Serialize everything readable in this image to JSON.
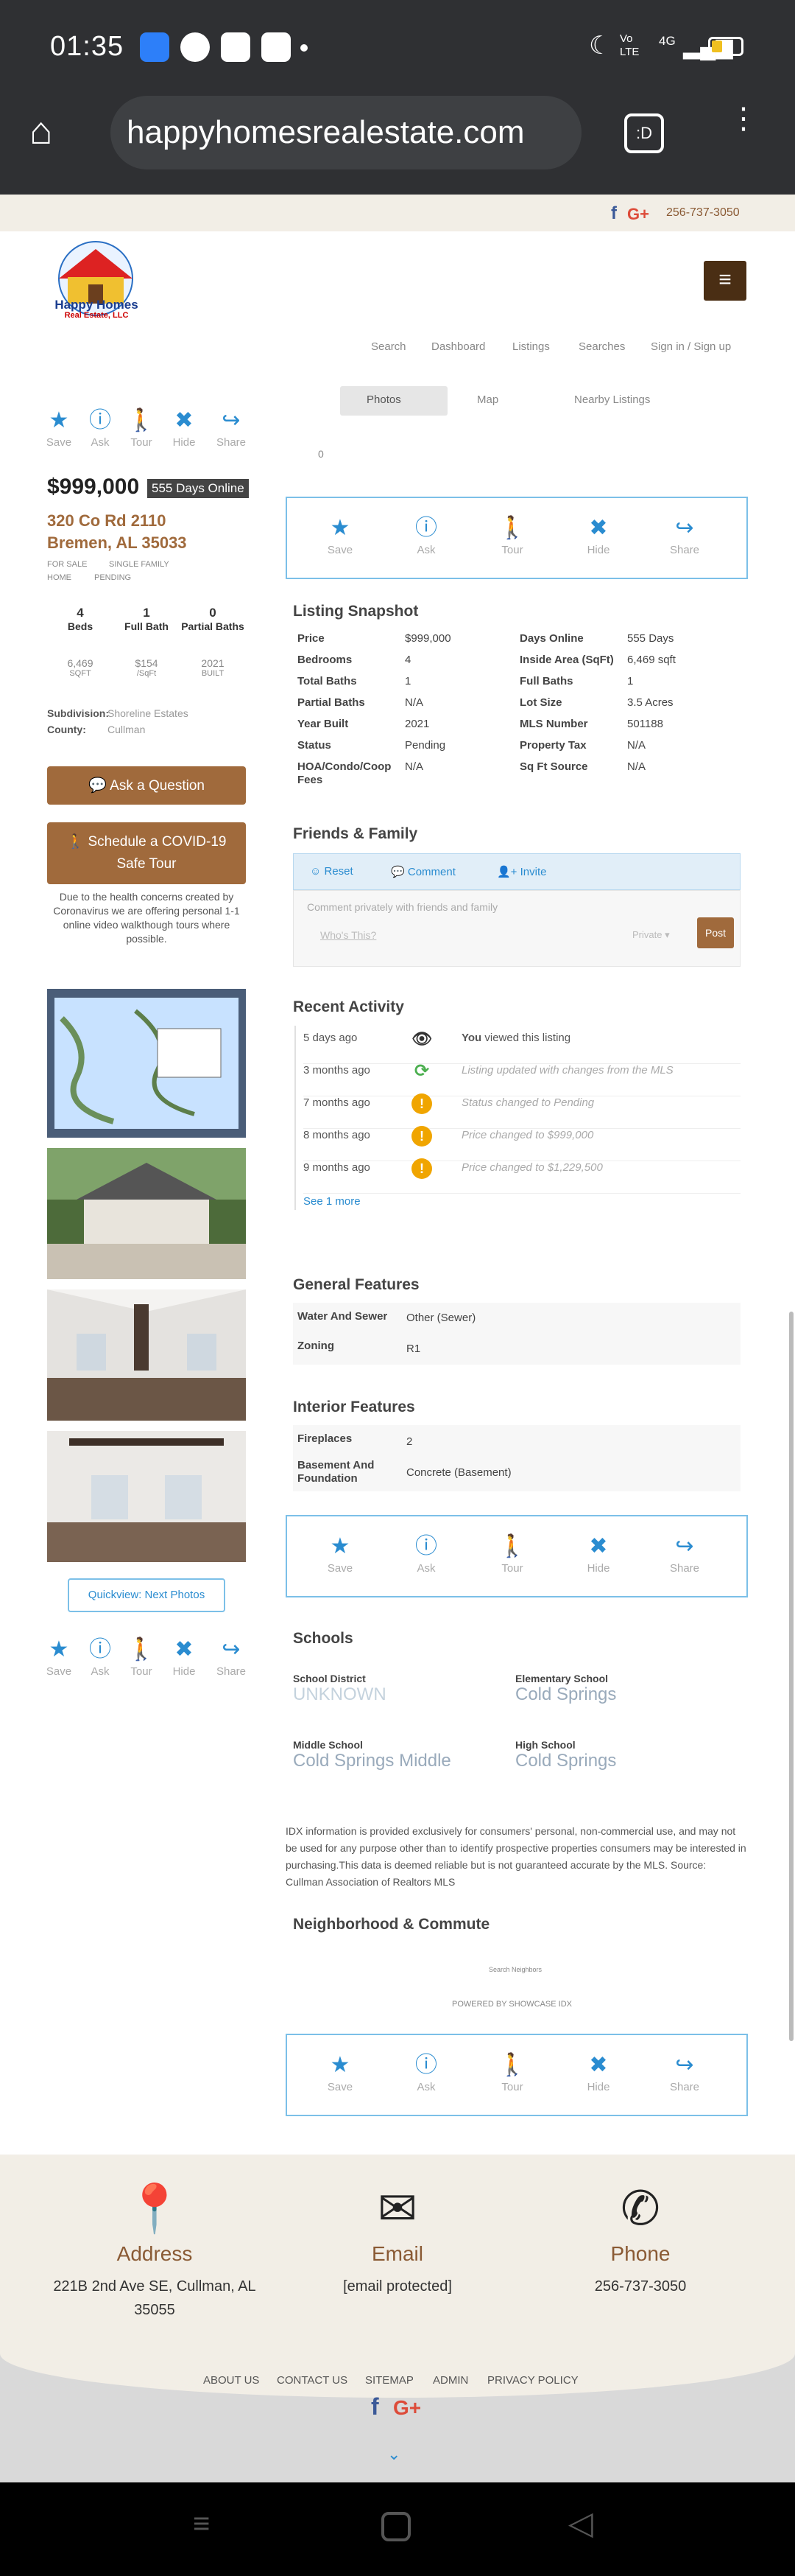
{
  "statusbar": {
    "time": "01:35",
    "network": "4G",
    "volte": "Vo LTE"
  },
  "browser": {
    "url": "happyhomesrealestate.com",
    "tab_badge": ":D"
  },
  "topbar": {
    "phone": "256-737-3050"
  },
  "logo": {
    "name": "Happy Homes",
    "subtitle": "Real Estate, LLC"
  },
  "nav": [
    "Search",
    "Dashboard",
    "Listings",
    "Searches",
    "Sign in / Sign up"
  ],
  "view_tabs": [
    "Photos",
    "Map",
    "Nearby Listings"
  ],
  "map_zero": "0",
  "actions": [
    "Save",
    "Ask",
    "Tour",
    "Hide",
    "Share"
  ],
  "listing": {
    "price": "$999,000",
    "days_online": "555 Days Online",
    "address1": "320 Co Rd 2110",
    "address2": "Bremen, AL 35033",
    "tags": [
      "FOR SALE",
      "SINGLE FAMILY",
      "HOME",
      "PENDING"
    ],
    "stats": [
      {
        "value": "4",
        "label": "Beds"
      },
      {
        "value": "1",
        "label": "Full Bath"
      },
      {
        "value": "0",
        "label": "Partial Baths"
      }
    ],
    "stats2": [
      {
        "value": "6,469",
        "label": "SQFT"
      },
      {
        "value": "$154",
        "label": "/SqFt"
      },
      {
        "value": "2021",
        "label": "BUILT"
      }
    ],
    "subdivision_label": "Subdivision:",
    "subdivision": "Shoreline Estates",
    "county_label": "County:",
    "county": "Cullman"
  },
  "buttons": {
    "ask": "Ask a Question",
    "tour_line1": "Schedule a COVID-19",
    "tour_line2": "Safe Tour",
    "quickview": "Quickview: Next Photos"
  },
  "covid_note": "Due to the health concerns created by Coronavirus we are offering personal 1-1 online video walkthough tours where possible.",
  "snapshot": {
    "title": "Listing Snapshot",
    "left": [
      [
        "Price",
        "$999,000"
      ],
      [
        "Bedrooms",
        "4"
      ],
      [
        "Total Baths",
        "1"
      ],
      [
        "Partial Baths",
        "N/A"
      ],
      [
        "Year Built",
        "2021"
      ],
      [
        "Status",
        "Pending"
      ],
      [
        "HOA/Condo/Coop Fees",
        "N/A"
      ]
    ],
    "right": [
      [
        "Days Online",
        "555 Days"
      ],
      [
        "Inside Area (SqFt)",
        "6,469 sqft"
      ],
      [
        "Full Baths",
        "1"
      ],
      [
        "Lot Size",
        "3.5 Acres"
      ],
      [
        "MLS Number",
        "501188"
      ],
      [
        "Property Tax",
        "N/A"
      ],
      [
        "Sq Ft Source",
        "N/A"
      ]
    ]
  },
  "friends": {
    "title": "Friends & Family",
    "reset": "Reset",
    "comment": "Comment",
    "invite": "Invite",
    "placeholder": "Comment privately with friends and family",
    "share_label": "Who's This?",
    "privacy": "Private",
    "post": "Post"
  },
  "activity": {
    "title": "Recent Activity",
    "rows": [
      {
        "when": "5 days ago",
        "prefix": "You",
        "text": " viewed this listing",
        "icon": "eye-icon",
        "color": "#333333"
      },
      {
        "when": "3 months ago",
        "prefix": "",
        "text": "Listing updated with changes from the MLS",
        "icon": "refresh-icon",
        "color": "#4caf50"
      },
      {
        "when": "7 months ago",
        "prefix": "",
        "text": "Status changed to Pending",
        "icon": "alert-icon",
        "color": "#f0a500"
      },
      {
        "when": "8 months ago",
        "prefix": "",
        "text": "Price changed to $999,000",
        "icon": "alert-icon",
        "color": "#f0a500"
      },
      {
        "when": "9 months ago",
        "prefix": "",
        "text": "Price changed to $1,229,500",
        "icon": "alert-icon",
        "color": "#f0a500"
      }
    ],
    "see_more": "See 1 more"
  },
  "general": {
    "title": "General Features",
    "rows": [
      [
        "Water And Sewer",
        "Other (Sewer)"
      ],
      [
        "Zoning",
        "R1"
      ]
    ]
  },
  "interior": {
    "title": "Interior Features",
    "rows": [
      [
        "Fireplaces",
        "2"
      ],
      [
        "Basement And Foundation",
        "Concrete (Basement)"
      ]
    ]
  },
  "schools": {
    "title": "Schools",
    "items": [
      {
        "label": "School District",
        "value": "UNKNOWN"
      },
      {
        "label": "Elementary School",
        "value": "Cold Springs"
      },
      {
        "label": "Middle School",
        "value": "Cold Springs Middle"
      },
      {
        "label": "High School",
        "value": "Cold Springs"
      }
    ]
  },
  "disclaimer": "IDX information is provided exclusively for consumers' personal, non-commercial use, and may not be used for any purpose other than to identify prospective properties consumers may be interested in purchasing.This data is deemed reliable but is not guaranteed accurate by the MLS. Source: Cullman Association of Realtors MLS",
  "neighborhood": {
    "title": "Neighborhood & Commute",
    "search": "Search Neighbors",
    "powered": "POWERED BY SHOWCASE IDX"
  },
  "footer": {
    "address_title": "Address",
    "address_line1": "221B 2nd Ave SE, Cullman, AL",
    "address_line2": "35055",
    "email_title": "Email",
    "email": "[email protected]",
    "phone_title": "Phone",
    "phone": "256-737-3050",
    "links": [
      "ABOUT US",
      "CONTACT US",
      "SITEMAP",
      "ADMIN",
      "PRIVACY POLICY"
    ]
  },
  "colors": {
    "accent": "#2a8cd0",
    "tan": "#a06a3c",
    "statusbar": "#2f3033"
  }
}
